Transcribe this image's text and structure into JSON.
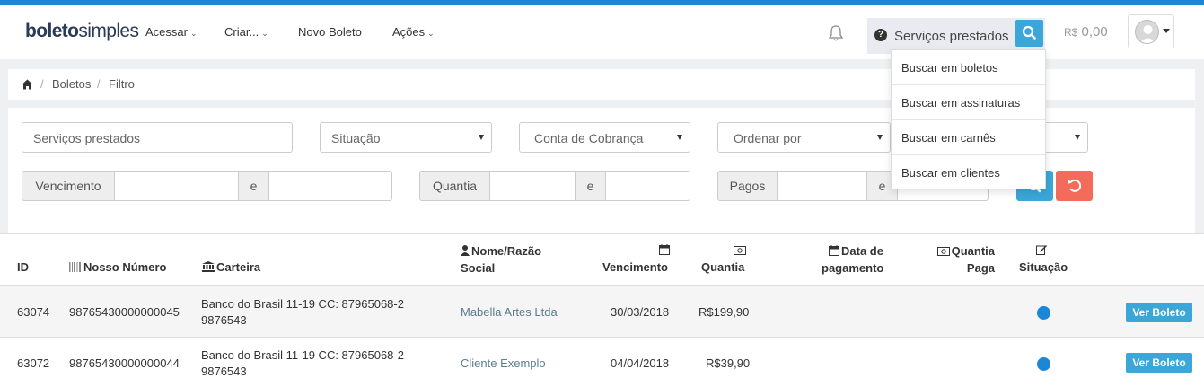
{
  "app": {
    "logo_bold": "boleto",
    "logo_light": "simples"
  },
  "nav": {
    "items": [
      {
        "label": "Acessar",
        "dropdown": true
      },
      {
        "label": "Criar...",
        "dropdown": true
      },
      {
        "label": "Novo Boleto",
        "dropdown": false
      },
      {
        "label": "Ações",
        "dropdown": true
      }
    ]
  },
  "search": {
    "value": "Serviços prestados",
    "help_icon": "question-circle-icon",
    "button_icon": "search-icon"
  },
  "balance": {
    "currency": "R$",
    "amount": "0,00"
  },
  "user": {
    "avatar_icon": "user-avatar-icon"
  },
  "dropdown": {
    "items": [
      "Buscar em boletos",
      "Buscar em assinaturas",
      "Buscar em carnês",
      "Buscar em clientes"
    ]
  },
  "breadcrumb": {
    "items": [
      "Boletos",
      "Filtro"
    ],
    "separator": "/"
  },
  "filters": {
    "text_value": "Serviços prestados",
    "selects": [
      "Situação",
      "Conta de Cobrança",
      "Ordenar por"
    ],
    "vencimento_label": "Vencimento",
    "quantia_label": "Quantia",
    "pagos_label": "Pagos",
    "and_label": "e"
  },
  "table": {
    "headers": {
      "id": "ID",
      "nosso": "Nosso Número",
      "carteira": "Carteira",
      "nome_1": "Nome/Razão",
      "nome_2": "Social",
      "vencimento": "Vencimento",
      "quantia": "Quantia",
      "data_pag_1": "Data de",
      "data_pag_2": "pagamento",
      "quantia_paga_1": "Quantia",
      "quantia_paga_2": "Paga",
      "situacao": "Situação"
    },
    "rows": [
      {
        "id": "63074",
        "nosso": "98765430000000045",
        "carteira_1": "Banco do Brasil 11-19 CC: 87965068-2",
        "carteira_2": "9876543",
        "nome": "Mabella Artes Ltda",
        "vencimento": "30/03/2018",
        "quantia": "R$199,90",
        "data_pagamento": "",
        "quantia_paga": "",
        "situacao_color": "#1b87d6",
        "action": "Ver Boleto"
      },
      {
        "id": "63072",
        "nosso": "98765430000000044",
        "carteira_1": "Banco do Brasil 11-19 CC: 87965068-2",
        "carteira_2": "9876543",
        "nome": "Cliente Exemplo",
        "vencimento": "04/04/2018",
        "quantia": "R$39,90",
        "data_pagamento": "",
        "quantia_paga": "",
        "situacao_color": "#1b87d6",
        "action": "Ver Boleto"
      }
    ]
  },
  "colors": {
    "accent": "#1b87d6",
    "button": "#3aa7d8",
    "danger": "#f36b5a"
  }
}
